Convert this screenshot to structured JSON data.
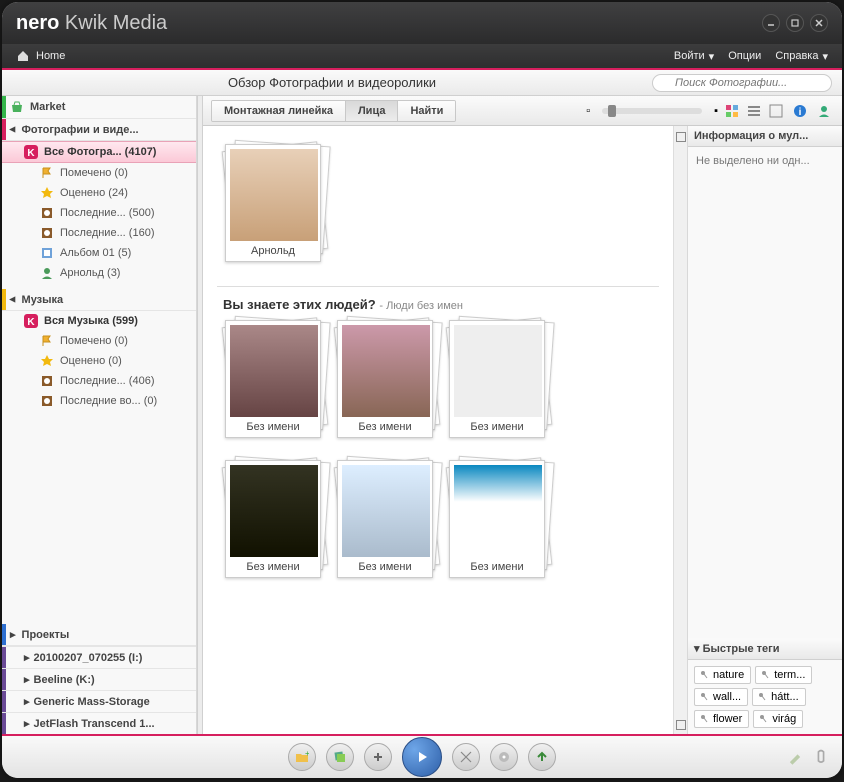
{
  "app": {
    "brand": "nero",
    "product": "Kwik Media"
  },
  "menubar": {
    "home": "Home",
    "login": "Войти",
    "options": "Опции",
    "help": "Справка"
  },
  "subhead": {
    "title": "Обзор Фотографии и видеоролики",
    "search_placeholder": "Поиск Фотографии..."
  },
  "sidebar": {
    "market": "Market",
    "photos_section": "Фотографии и виде...",
    "all_photos": "Все Фотогра... (4107)",
    "photo_children": [
      {
        "icon": "flag",
        "label": "Помечено (0)"
      },
      {
        "icon": "star",
        "label": "Оценено (24)"
      },
      {
        "icon": "recent",
        "label": "Последние... (500)"
      },
      {
        "icon": "recent",
        "label": "Последние... (160)"
      },
      {
        "icon": "album",
        "label": "Альбом 01 (5)"
      },
      {
        "icon": "face",
        "label": "Арнольд (3)"
      }
    ],
    "music_section": "Музыка",
    "all_music": "Вся Музыка (599)",
    "music_children": [
      {
        "icon": "flag",
        "label": "Помечено (0)"
      },
      {
        "icon": "star",
        "label": "Оценено (0)"
      },
      {
        "icon": "recent",
        "label": "Последние... (406)"
      },
      {
        "icon": "recent",
        "label": "Последние во... (0)"
      }
    ],
    "projects": "Проекты",
    "drives": [
      "20100207_070255 (I:)",
      "Beeline (K:)",
      "Generic Mass-Storage",
      "JetFlash Transcend 1..."
    ]
  },
  "tabs": {
    "timeline": "Монтажная линейка",
    "faces": "Лица",
    "find": "Найти"
  },
  "named_stack": {
    "caption": "Арнольд"
  },
  "unnamed_header": {
    "title": "Вы знаете этих людей?",
    "sub": "- Люди без имен"
  },
  "unnamed_caption": "Без имени",
  "right": {
    "info_head": "Информация о мул...",
    "info_body": "Не выделено ни одн...",
    "tags_head": "Быстрые теги",
    "tags": [
      "nature",
      "term...",
      "wall...",
      "hátt...",
      "flower",
      "virág"
    ]
  }
}
